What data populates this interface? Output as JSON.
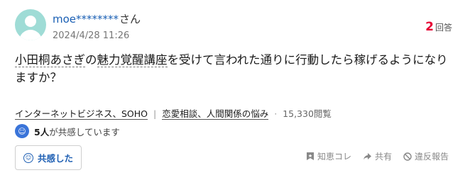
{
  "user": {
    "name": "moe********",
    "suffix": "さん",
    "timestamp": "2024/4/28 11:26"
  },
  "answers": {
    "count": "2",
    "label": "回答"
  },
  "question": {
    "kw1": "小田桐あさぎ",
    "t1": "の",
    "kw2": "魅力覚醒講座",
    "t2": "を受けて言われた通りに行動したら稼げるようになりますか？"
  },
  "category": {
    "primary": "インターネットビジネス、SOHO",
    "secondary": "恋愛相談、人間関係の悩み",
    "views": "15,330閲覧"
  },
  "empathy": {
    "count": "5人",
    "text": "が共感しています",
    "button_label": "共感した"
  },
  "actions": {
    "chiebookmark": "知恵コレ",
    "share": "共有",
    "report": "違反報告"
  },
  "colors": {
    "accent_blue": "#1e5fb3",
    "answer_red": "#e60033",
    "avatar_bg": "#9fdcd6"
  }
}
